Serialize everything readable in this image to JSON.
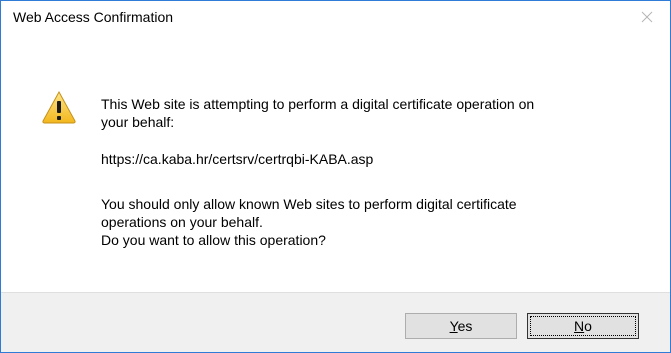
{
  "window": {
    "title": "Web Access Confirmation",
    "close_icon": "close-icon"
  },
  "message": {
    "icon": "warning-icon",
    "line1": "This Web site is attempting to perform a digital certificate operation on",
    "line1b": "your behalf:",
    "url": "https://ca.kaba.hr/certsrv/certrqbi-KABA.asp",
    "line2": "You should only allow known Web sites to perform digital certificate",
    "line2b": "operations on your behalf.",
    "line3": "Do you want to allow this operation?"
  },
  "buttons": {
    "yes_accel": "Y",
    "yes_rest": "es",
    "no_accel": "N",
    "no_rest": "o",
    "default": "No"
  },
  "colors": {
    "window_border": "#2f7bd6",
    "footer_bg": "#f0f0f0",
    "button_bg": "#e1e1e1",
    "warning_yellow": "#f6c22b"
  }
}
